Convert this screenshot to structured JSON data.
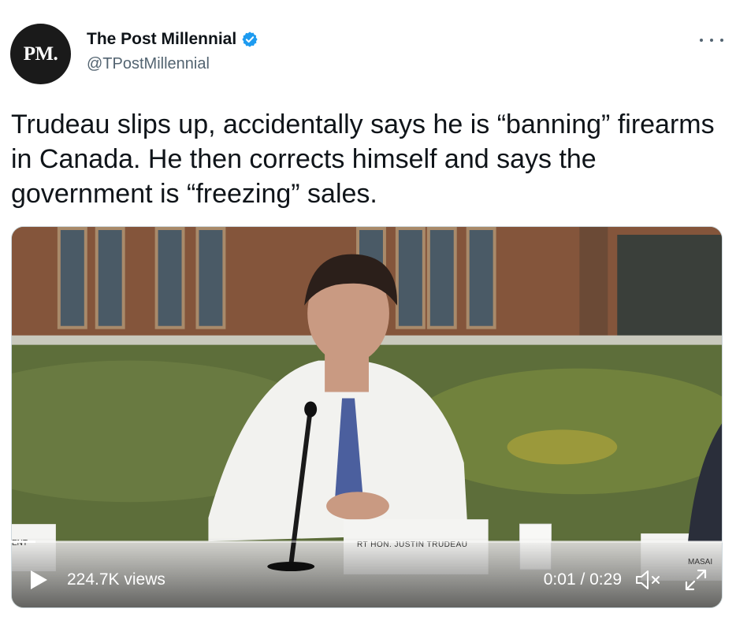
{
  "header": {
    "avatar_text": "PM.",
    "display_name": "The Post Millennial",
    "handle": "@TPostMillennial",
    "verified_color": "#1d9bf0",
    "more_icon": "more-horizontal-icon"
  },
  "tweet": {
    "text": "Trudeau slips up, accidentally says he is “banning” firearms in Canada. He then corrects himself and says the government is “freezing” sales."
  },
  "video": {
    "views": "224.7K views",
    "time": "0:01 / 0:29",
    "progress": 0.034,
    "placard_text": "RT HON. JUSTIN TRUDEAU",
    "side_placard_text": "MASAI",
    "left_placard_text": "ENT",
    "icons": [
      "play-icon",
      "mute-icon",
      "expand-icon"
    ]
  }
}
